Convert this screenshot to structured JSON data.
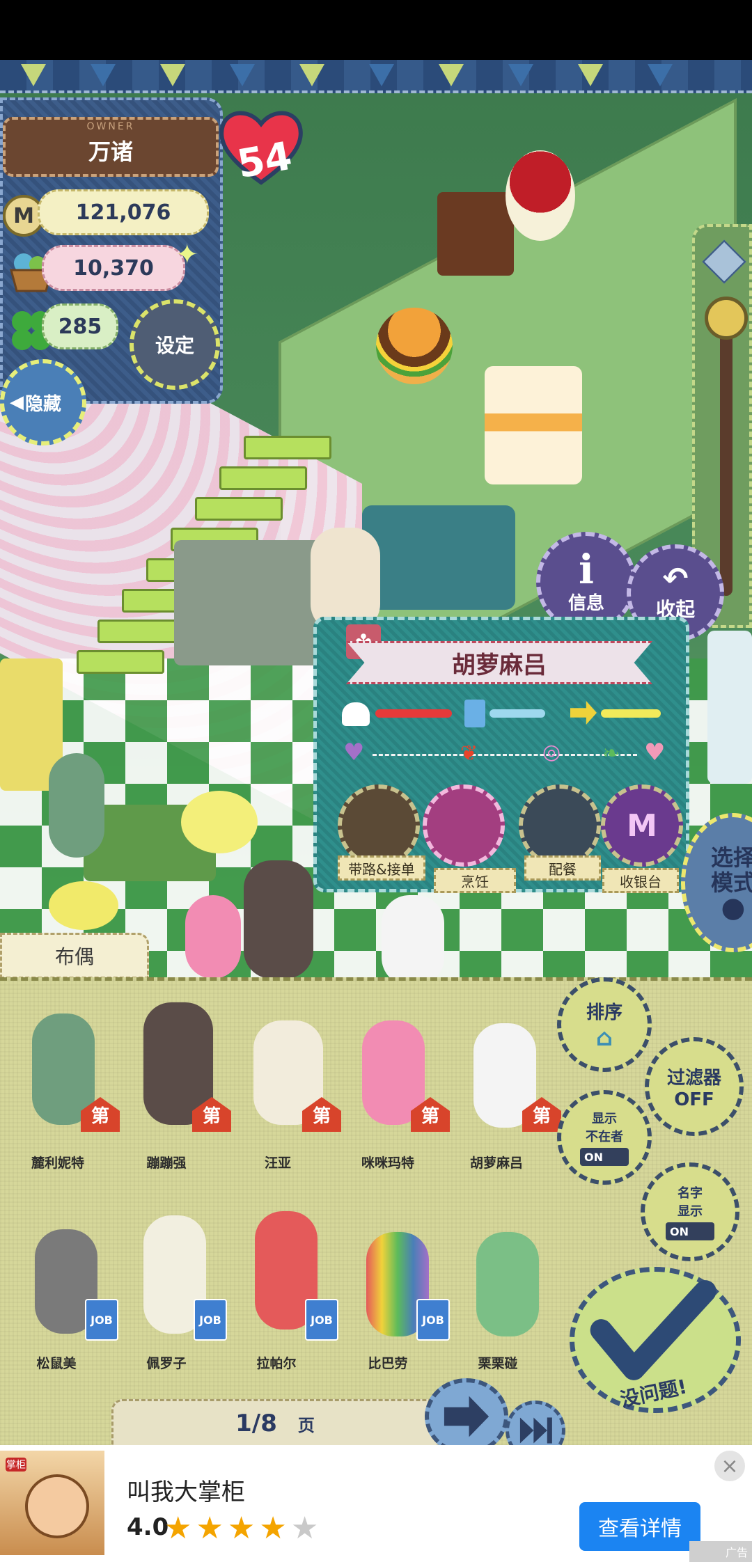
{
  "owner": {
    "tag": "OWNER",
    "name": "万诸",
    "hearts": "54",
    "coins": "121,076",
    "vegetables": "10,370",
    "clovers": "285",
    "coin_symbol": "M"
  },
  "buttons": {
    "settings": "设定",
    "hide": "隐藏",
    "info": "信息",
    "collapse": "收起",
    "mode": [
      "选择",
      "模式"
    ]
  },
  "selected_character": {
    "name": "胡萝麻吕",
    "roles": [
      "带路&接单",
      "烹饪",
      "配餐",
      "收银台"
    ],
    "role_symbol": "M"
  },
  "roster": {
    "tab": "布偶",
    "first_row": [
      {
        "name": "麓利妮特",
        "badge": "第"
      },
      {
        "name": "蹦蹦强",
        "badge": "第"
      },
      {
        "name": "汪亚",
        "badge": "第"
      },
      {
        "name": "咪咪玛特",
        "badge": "第"
      },
      {
        "name": "胡萝麻吕",
        "badge": "第"
      }
    ],
    "second_row": [
      {
        "name": "松鼠美",
        "badge": "JOB"
      },
      {
        "name": "佩罗子",
        "badge": "JOB"
      },
      {
        "name": "拉帕尔",
        "badge": "JOB"
      },
      {
        "name": "比巴劳",
        "badge": "JOB"
      },
      {
        "name": "栗栗碰",
        "badge": ""
      }
    ],
    "sort": "排序",
    "filter": [
      "过滤器",
      "OFF"
    ],
    "show_absent": [
      "显示",
      "不在者"
    ],
    "show_name": [
      "名字",
      "显示"
    ],
    "toggle_on": "ON",
    "ok": "没问题!",
    "page_current": "1/8",
    "page_unit": "页"
  },
  "ad": {
    "title": "叫我大掌柜",
    "rating": "4.0",
    "stars_filled": 4,
    "stars_total": 5,
    "cta": "查看详情",
    "close": "×",
    "mark": "广告",
    "thumb_text": "掌柜"
  },
  "colors": {
    "accent_blue": "#1b84f2",
    "heart_red": "#e8344a",
    "badge_red": "#d8442b",
    "panel_teal": "#2f8f8c"
  }
}
